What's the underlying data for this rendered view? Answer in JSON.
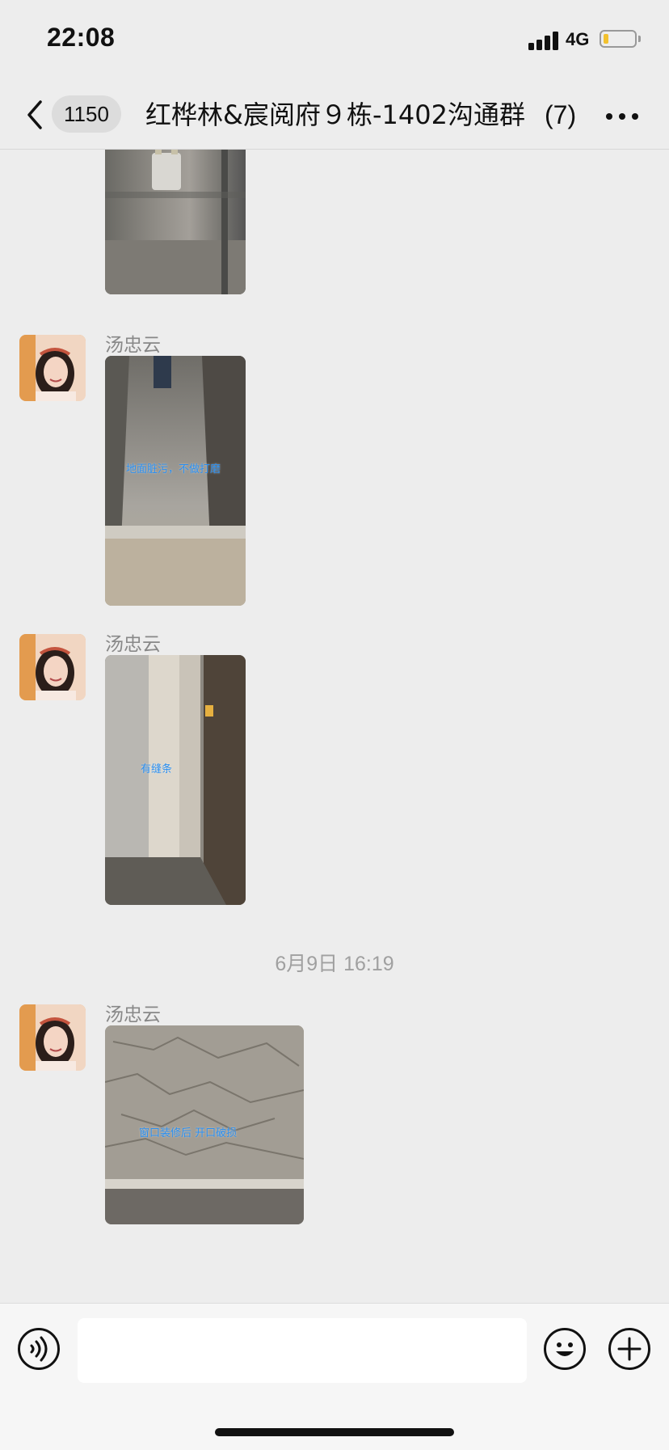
{
  "status": {
    "time": "22:08",
    "network": "4G"
  },
  "nav": {
    "unread_count": "1150",
    "title": "红桦林&宸阅府９栋-1402沟通群",
    "member_count": "(7)"
  },
  "messages": [
    {
      "sender": "汤忠云",
      "caption": "地面脏污，不做打磨"
    },
    {
      "sender": "汤忠云",
      "caption": "有缝条"
    },
    {
      "sender": "汤忠云",
      "caption": "窗口装修后 开口破损"
    }
  ],
  "timestamp": "6月9日 16:19",
  "input": {
    "placeholder": ""
  },
  "icons": {
    "back": "chevron-left-icon",
    "more": "more-dots-icon",
    "voice": "voice-icon",
    "emoji": "emoji-icon",
    "plus": "plus-icon"
  }
}
